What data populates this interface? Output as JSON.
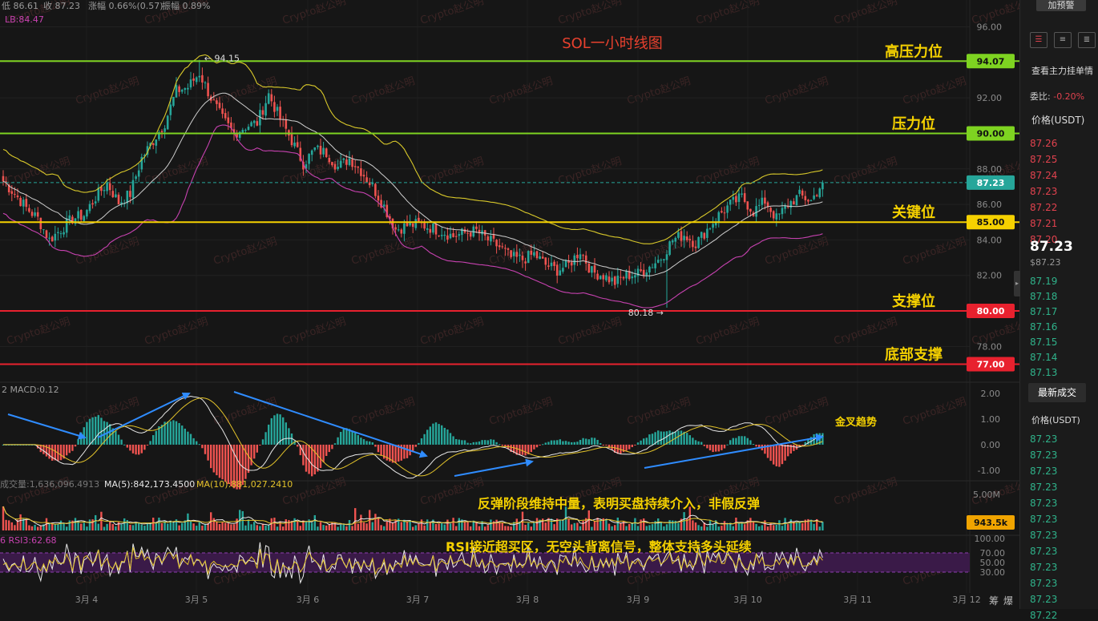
{
  "header": {
    "low": "低 86.61",
    "close": "收 87.23",
    "change": "涨幅 0.66%(0.57)",
    "amplitude": "振幅 0.89%",
    "lb": "LB:84.47"
  },
  "chart_title": "SOL一小时线图",
  "watermark": "Crypto赵公明",
  "chart_data": {
    "type": "candlestick",
    "symbol": "SOL/USDT",
    "interval": "1h",
    "title": "SOL一小时线图",
    "y_axis": {
      "ticks": [
        "96.00",
        "94.00",
        "92.00",
        "90.00",
        "88.00",
        "86.00",
        "84.00",
        "82.00",
        "80.00",
        "78.00"
      ],
      "ylim": [
        76.3,
        96.7
      ]
    },
    "x_axis": {
      "ticks": [
        "3月 4",
        "3月 5",
        "3月 6",
        "3月 7",
        "3月 8",
        "3月 9",
        "3月 10",
        "3月 11",
        "3月 12"
      ]
    },
    "last_price": 87.23,
    "high_mark": 94.15,
    "low_mark": 80.18,
    "levels": [
      {
        "label": "高压力位",
        "price": 94.07,
        "tag": "94.07",
        "color": "#7ed321",
        "tagText": "#111111",
        "labelColor": "#f5d100"
      },
      {
        "label": "压力位",
        "price": 90.0,
        "tag": "90.00",
        "color": "#7ed321",
        "tagText": "#111111",
        "labelColor": "#f5d100"
      },
      {
        "label": "关键位",
        "price": 85.0,
        "tag": "85.00",
        "color": "#f5d100",
        "tagText": "#111111",
        "labelColor": "#f5d100"
      },
      {
        "label": "支撑位",
        "price": 80.0,
        "tag": "80.00",
        "color": "#e8212e",
        "tagText": "#ffffff",
        "labelColor": "#f5d100"
      },
      {
        "label": "底部支撑",
        "price": 77.0,
        "tag": "77.00",
        "color": "#e8212e",
        "tagText": "#ffffff",
        "labelColor": "#f5d100"
      }
    ],
    "candle_anchors": [
      [
        0,
        87.3
      ],
      [
        4,
        86.6
      ],
      [
        8,
        85.8
      ],
      [
        12,
        85.2
      ],
      [
        16,
        84.0
      ],
      [
        20,
        84.6
      ],
      [
        24,
        85.2
      ],
      [
        28,
        85.4
      ],
      [
        32,
        86.4
      ],
      [
        36,
        87.2
      ],
      [
        40,
        86.1
      ],
      [
        44,
        86.6
      ],
      [
        48,
        88.6
      ],
      [
        52,
        89.6
      ],
      [
        56,
        90.6
      ],
      [
        60,
        92.4
      ],
      [
        64,
        92.6
      ],
      [
        68,
        93.4
      ],
      [
        72,
        92.0
      ],
      [
        76,
        90.8
      ],
      [
        80,
        90.0
      ],
      [
        84,
        90.4
      ],
      [
        88,
        90.6
      ],
      [
        92,
        92.2
      ],
      [
        96,
        90.8
      ],
      [
        100,
        89.6
      ],
      [
        104,
        88.3
      ],
      [
        108,
        89.1
      ],
      [
        112,
        88.9
      ],
      [
        116,
        88.1
      ],
      [
        120,
        88.6
      ],
      [
        124,
        87.9
      ],
      [
        128,
        87.0
      ],
      [
        132,
        85.9
      ],
      [
        136,
        84.6
      ],
      [
        140,
        84.8
      ],
      [
        144,
        84.9
      ],
      [
        148,
        84.7
      ],
      [
        152,
        84.5
      ],
      [
        156,
        84.2
      ],
      [
        160,
        84.4
      ],
      [
        164,
        84.5
      ],
      [
        168,
        84.0
      ],
      [
        172,
        83.6
      ],
      [
        176,
        83.0
      ],
      [
        180,
        82.9
      ],
      [
        184,
        83.2
      ],
      [
        188,
        82.6
      ],
      [
        192,
        82.3
      ],
      [
        196,
        82.6
      ],
      [
        200,
        83.4
      ],
      [
        204,
        82.2
      ],
      [
        208,
        82.0
      ],
      [
        212,
        81.6
      ],
      [
        216,
        82.0
      ],
      [
        220,
        82.1
      ],
      [
        224,
        82.5
      ],
      [
        228,
        83.0
      ],
      [
        232,
        84.0
      ],
      [
        236,
        84.3
      ],
      [
        240,
        83.8
      ],
      [
        244,
        84.6
      ],
      [
        248,
        85.4
      ],
      [
        252,
        86.0
      ],
      [
        256,
        86.4
      ],
      [
        260,
        85.6
      ],
      [
        264,
        86.2
      ],
      [
        268,
        85.2
      ],
      [
        272,
        86.0
      ],
      [
        276,
        86.5
      ],
      [
        280,
        86.2
      ],
      [
        284,
        87.23
      ]
    ],
    "indicators": {
      "macd": {
        "label": "MACD:0.12",
        "ticks": [
          "2.00",
          "1.00",
          "0.00",
          "-1.00"
        ]
      },
      "volume": {
        "label": "成交量:1,636,096.4913",
        "ma5": "MA(5):842,173.4500",
        "ma10": "MA(10):881,027.2410",
        "ticks": [
          "5.00M"
        ],
        "current": "943.5k"
      },
      "rsi": {
        "label": "RSI3:62.68",
        "ticks": [
          "100.00",
          "70.00",
          "50.00",
          "30.00"
        ]
      }
    },
    "annotations": [
      {
        "text": "金叉趋势",
        "color": "#f5d100"
      },
      {
        "text": "反弹阶段维持中量，表明买盘持续介入，非假反弹",
        "color": "#f5d100"
      },
      {
        "text": "RSI接近超买区，无空头背离信号，整体支持多头延续",
        "color": "#f5d100"
      }
    ],
    "corner_labels": {
      "left": "筹",
      "right": "爆"
    },
    "colors": {
      "up": "#26a69a",
      "down": "#ef5350",
      "background": "#161616"
    }
  },
  "orderbook": {
    "alert_button": "加预警",
    "main_orders": "查看主力挂单情",
    "ratio_label": "委比:",
    "ratio_value": "-0.20%",
    "price_header": "价格(USDT)",
    "asks": [
      "87.26",
      "87.25",
      "87.24",
      "87.23",
      "87.22",
      "87.21",
      "87.20"
    ],
    "last": "87.23",
    "last_usd": "$87.23",
    "bids": [
      "87.19",
      "87.18",
      "87.17",
      "87.16",
      "87.15",
      "87.14",
      "87.13"
    ],
    "trades_tab": "最新成交",
    "trades_header": "价格(USDT)",
    "trades": [
      "87.23",
      "87.23",
      "87.23",
      "87.23",
      "87.23",
      "87.23",
      "87.23",
      "87.23",
      "87.23",
      "87.23",
      "87.23",
      "87.22"
    ]
  }
}
